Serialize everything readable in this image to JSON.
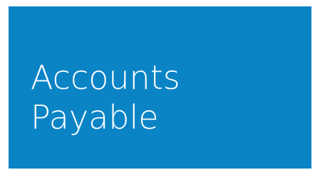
{
  "tile": {
    "label_line1": "Accounts",
    "label_line2": "Payable",
    "background_color": "#0b84c6",
    "text_color": "#ffffff"
  }
}
